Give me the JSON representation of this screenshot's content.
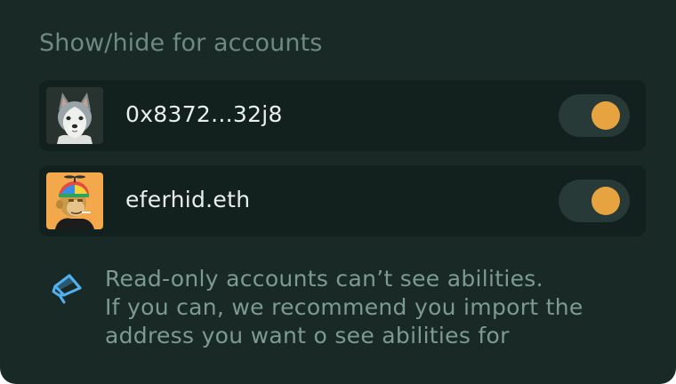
{
  "section": {
    "title": "Show/hide for accounts"
  },
  "accounts": [
    {
      "name": "0x8372...32j8",
      "avatar_icon": "husky-dog-avatar",
      "visible": true
    },
    {
      "name": "eferhid.eth",
      "avatar_icon": "bored-ape-avatar",
      "visible": true
    }
  ],
  "notice": {
    "icon": "megaphone-icon",
    "lines": [
      "Read-only accounts can’t see abilities.",
      "If you can, we recommend you import the",
      "address you want o see abilities for"
    ]
  },
  "colors": {
    "panel_bg": "#182926",
    "row_bg": "#13211e",
    "toggle_track": "#283a37",
    "toggle_knob": "#e8a341",
    "accent_icon": "#4fb1f0"
  }
}
